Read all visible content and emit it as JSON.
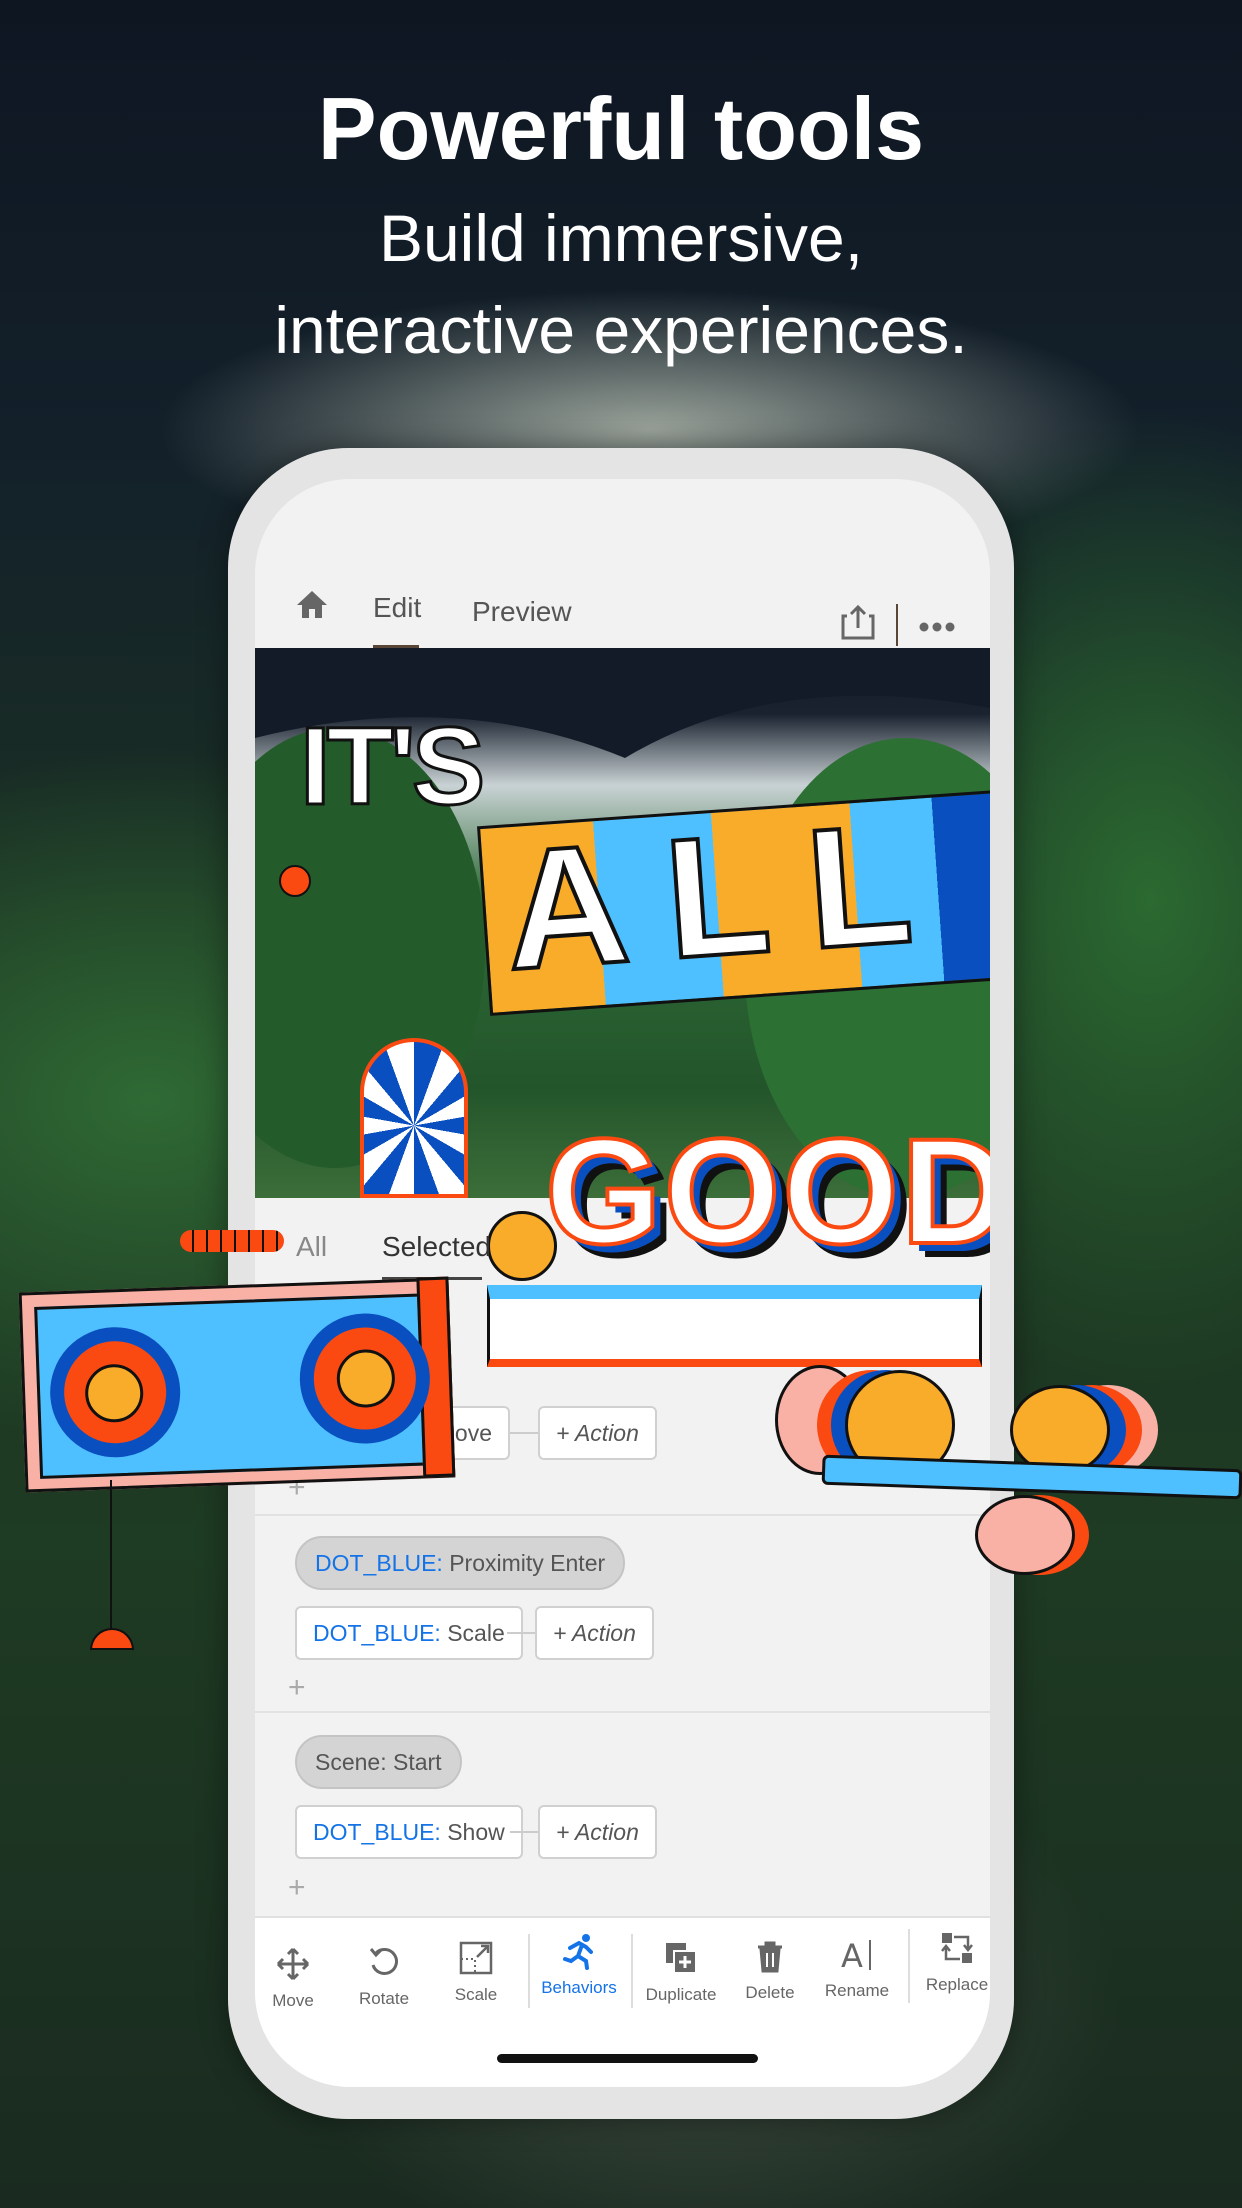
{
  "headline": {
    "title": "Powerful tools",
    "subtitle_line1": "Build immersive,",
    "subtitle_line2": "interactive experiences."
  },
  "nav": {
    "home_icon": "home-icon",
    "edit": "Edit",
    "preview": "Preview",
    "share_icon": "share-icon",
    "more_icon": "more-icon"
  },
  "artwork": {
    "word1": "IT'S",
    "word2": "ALL",
    "word3": "GOOD"
  },
  "filter_tabs": {
    "all": "All",
    "selected": "Selected"
  },
  "behaviors": [
    {
      "action_target": "",
      "action": "Move",
      "add_action": "+ Action"
    },
    {
      "trigger_target": "DOT_BLUE:",
      "trigger": "Proximity Enter",
      "action_target": "DOT_BLUE:",
      "action": "Scale",
      "add_action": "+ Action"
    },
    {
      "trigger": "Scene: Start",
      "action_target": "DOT_BLUE:",
      "action": "Show",
      "add_action": "+ Action"
    }
  ],
  "add_symbol": "+",
  "toolbar": [
    {
      "label": "Move",
      "icon": "move-icon"
    },
    {
      "label": "Rotate",
      "icon": "rotate-icon"
    },
    {
      "label": "Scale",
      "icon": "scale-icon"
    },
    {
      "label": "Behaviors",
      "icon": "behaviors-icon",
      "active": true
    },
    {
      "label": "Duplicate",
      "icon": "duplicate-icon"
    },
    {
      "label": "Delete",
      "icon": "delete-icon"
    },
    {
      "label": "Rename",
      "icon": "rename-icon"
    },
    {
      "label": "Replace",
      "icon": "replace-icon"
    }
  ],
  "colors": {
    "accent": "#1473e6",
    "orange": "#fa4a12",
    "yellow": "#f9ab2a",
    "sky": "#4fc0ff",
    "navy": "#0a4fc0",
    "pink": "#f9b1a5"
  }
}
